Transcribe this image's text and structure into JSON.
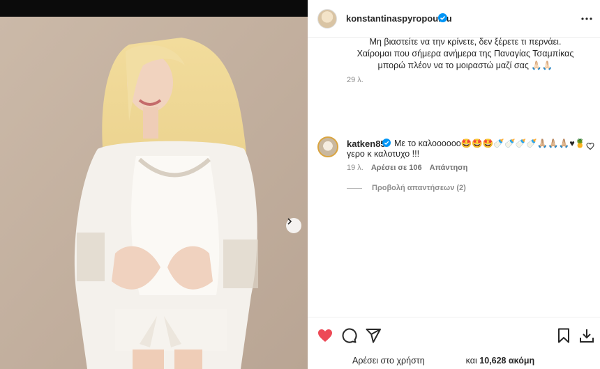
{
  "post": {
    "username": "konstantinaspyropoulou",
    "caption_lines": [
      "Μη βιαστείτε να την κρίνετε, δεν ξέρετε τι περνάει.",
      "Χαίρομαι που σήμερα ανήμερα της Παναγίας Τσαμπίκας",
      "μπορώ πλέον να το μοιραστώ μαζί σας 🙏🏻🙏🏻"
    ],
    "caption_time": "29 λ."
  },
  "comment": {
    "username": "katken85",
    "text_line1": "Με το καλοοοοοο🤩🤩🤩🍼🍼🍼🍼🙏🏼🙏🏼🙏🏼♥🍍",
    "text_line2": "γερο κ καλοτυχο !!!",
    "time": "19 λ.",
    "likes": "Αρέσει σε 106",
    "reply": "Απάντηση",
    "view_replies": "Προβολή απαντήσεων (2)"
  },
  "footer": {
    "likes_prefix": "Αρέσει στο χρήστη",
    "likes_and": "και",
    "likes_count": "10,628 ακόμη"
  },
  "colors": {
    "like_red": "#ed4956",
    "verified_blue": "#0095f6",
    "photo_bg": "#c8b6a6"
  },
  "icons": [
    "verified-icon",
    "more-icon",
    "chevron-right-icon",
    "heart-icon",
    "comment-icon",
    "share-icon",
    "bookmark-icon",
    "download-icon"
  ]
}
